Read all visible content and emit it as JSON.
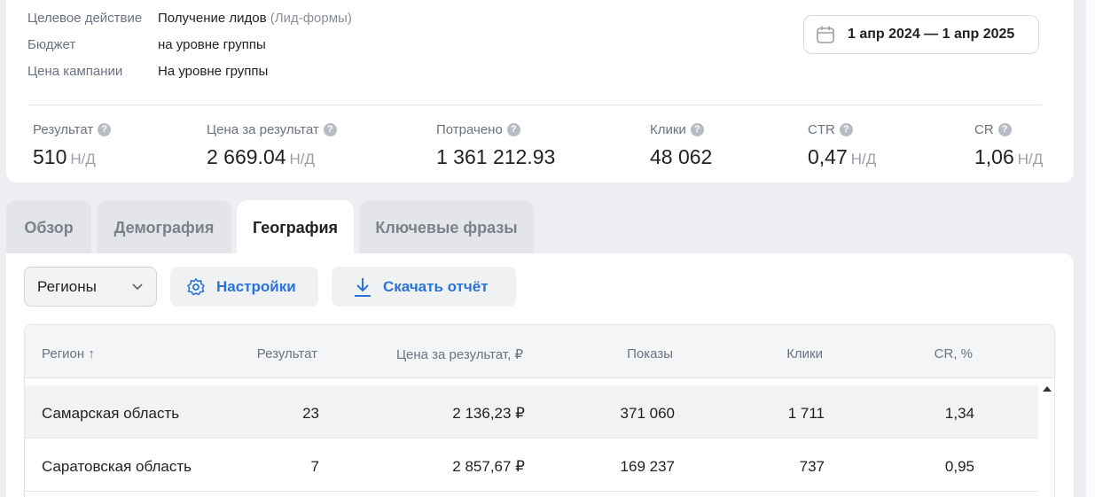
{
  "campaign": {
    "target_action_label": "Целевое действие",
    "target_action_value": "Получение лидов",
    "target_action_sub": "(Лид-формы)",
    "budget_label": "Бюджет",
    "budget_value": "на уровне группы",
    "price_label": "Цена кампании",
    "price_value": "На уровне группы"
  },
  "date_range": "1 апр 2024 — 1 апр 2025",
  "metrics": [
    {
      "label": "Результат",
      "value": "510",
      "suffix": "Н/Д"
    },
    {
      "label": "Цена за результат",
      "value": "2 669.04",
      "suffix": "Н/Д"
    },
    {
      "label": "Потрачено",
      "value": "1 361 212.93",
      "suffix": ""
    },
    {
      "label": "Клики",
      "value": "48 062",
      "suffix": ""
    },
    {
      "label": "CTR",
      "value": "0,47",
      "suffix": "Н/Д"
    },
    {
      "label": "CR",
      "value": "1,06",
      "suffix": "Н/Д"
    }
  ],
  "help_glyph": "?",
  "tabs": [
    "Обзор",
    "Демография",
    "География",
    "Ключевые фразы"
  ],
  "active_tab": "География",
  "toolbar": {
    "select_value": "Регионы",
    "settings_label": "Настройки",
    "download_label": "Скачать отчёт"
  },
  "table": {
    "headers": [
      "Регион ↑",
      "Результат",
      "Цена за результат, ₽",
      "Показы",
      "Клики",
      "CR, %"
    ],
    "rows": [
      [
        "Самарская область",
        "23",
        "2 136,23 ₽",
        "371 060",
        "1 711",
        "1,34"
      ],
      [
        "Саратовская область",
        "7",
        "2 857,67 ₽",
        "169 237",
        "737",
        "0,95"
      ]
    ]
  },
  "colors": {
    "accent": "#2a74d8",
    "background": "#eceef2"
  }
}
